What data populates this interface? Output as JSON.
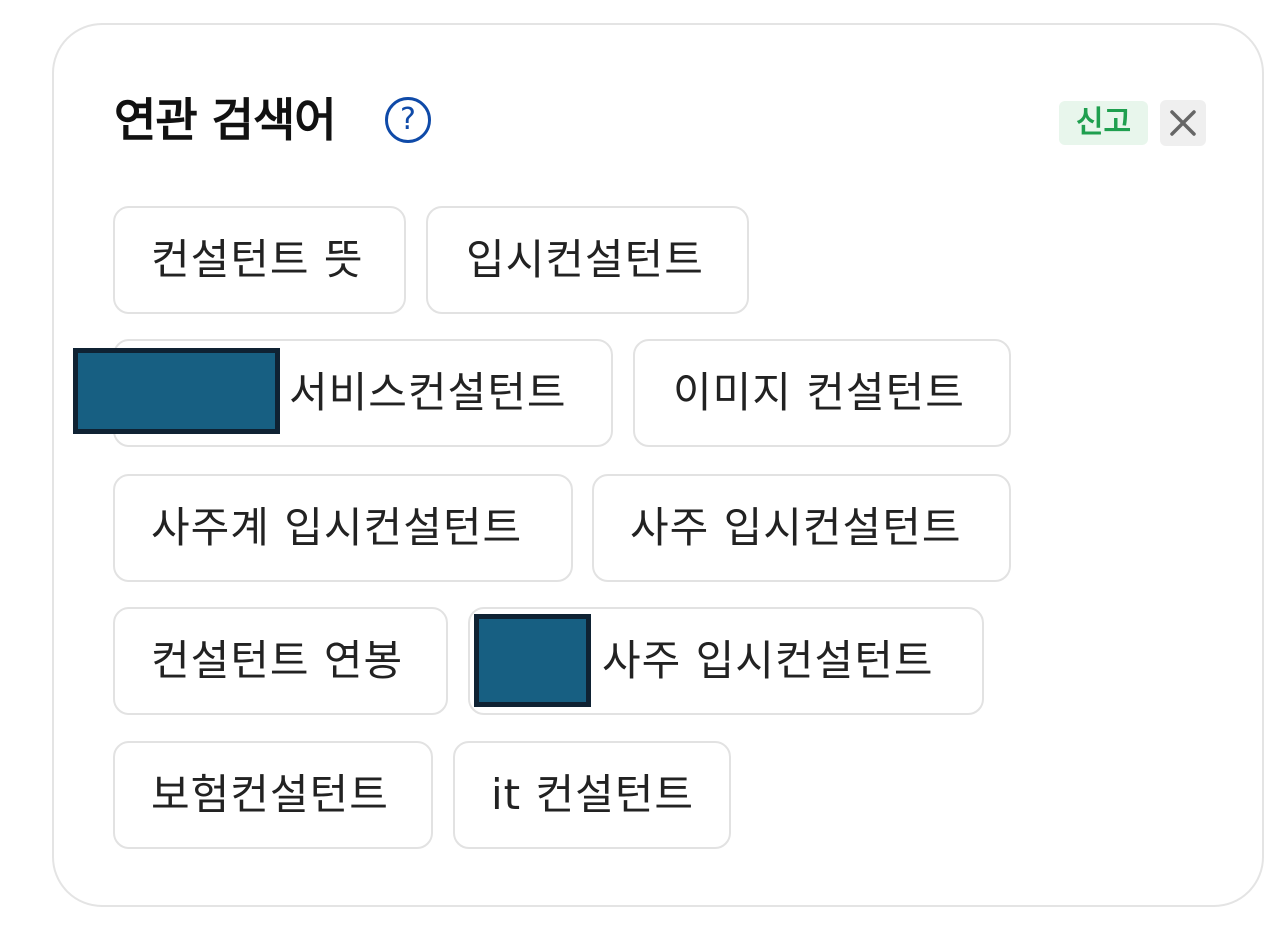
{
  "header": {
    "title": "연관 검색어",
    "help_symbol": "?",
    "report_label": "신고"
  },
  "keywords": [
    "컨설턴트 뜻",
    "입시컨설턴트",
    "서비스컨설턴트",
    "이미지 컨설턴트",
    "사주계 입시컨설턴트",
    "사주 입시컨설턴트",
    "컨설턴트 연봉",
    "사주 입시컨설턴트",
    "보험컨설턴트",
    "it 컨설턴트"
  ],
  "icons": {
    "help": "question-circle-icon",
    "close": "close-icon"
  },
  "colors": {
    "help_icon": "#0f4aa8",
    "report_text": "#1f9f4f",
    "report_bg": "#e8f6ec",
    "redaction_fill": "#175f82"
  }
}
